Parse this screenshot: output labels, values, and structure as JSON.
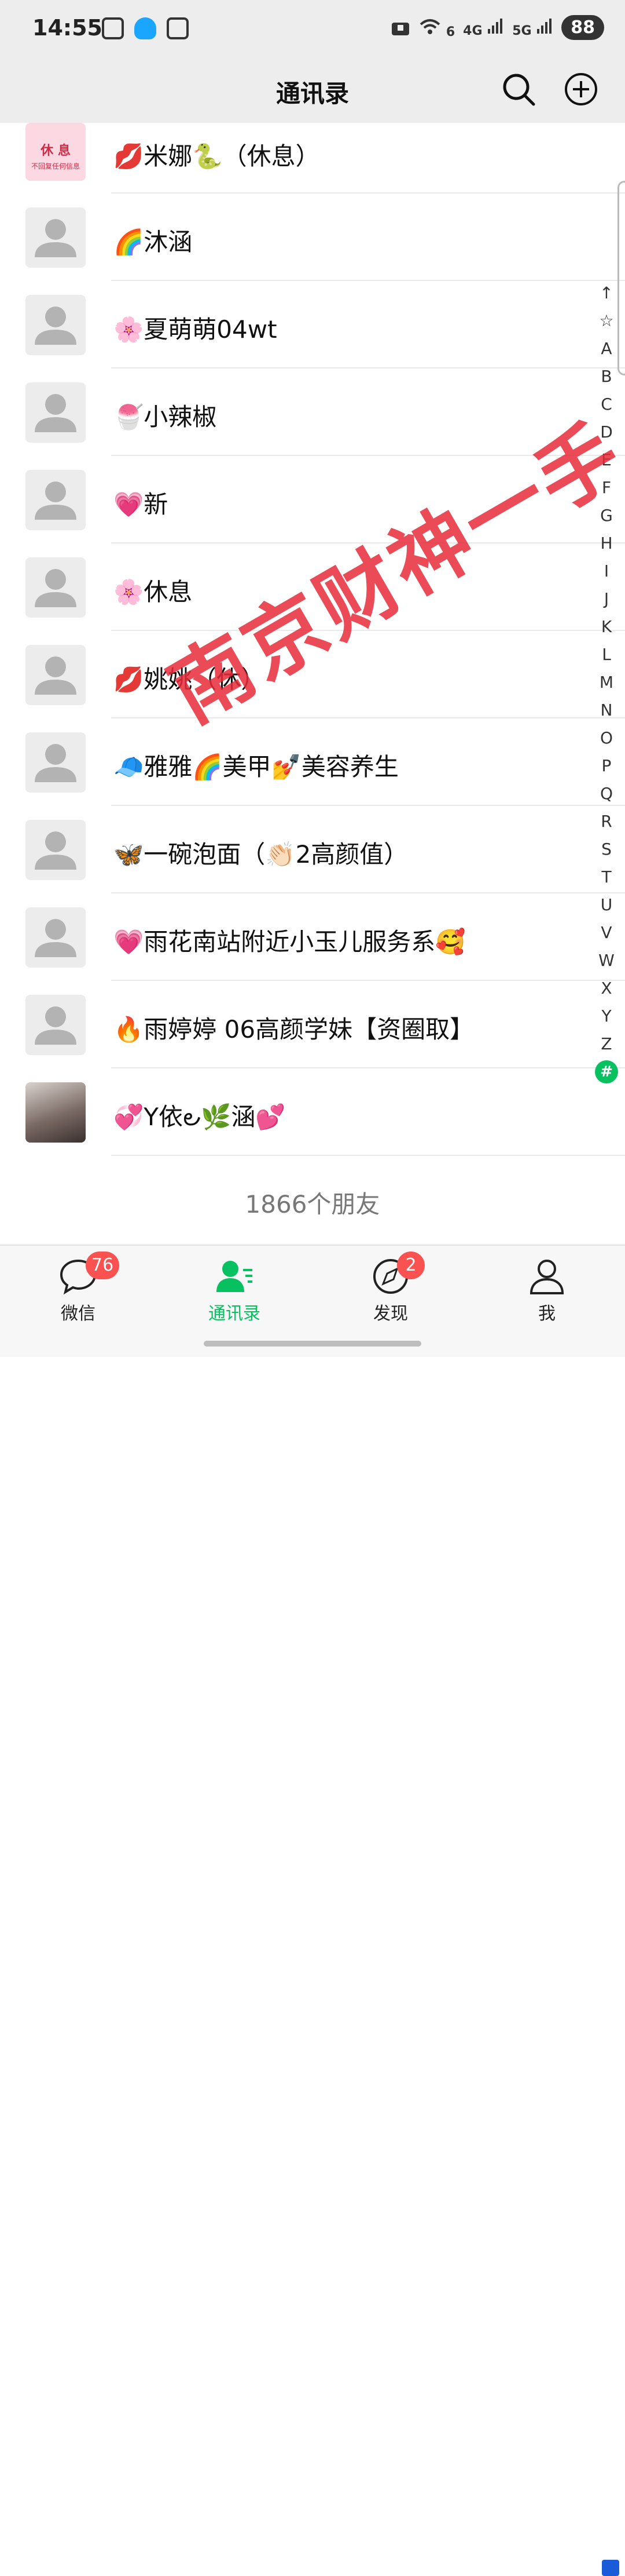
{
  "status_bar": {
    "time": "14:55",
    "battery": "88",
    "net_4g": "4G",
    "net_5g": "5G",
    "wifi_sub": "6"
  },
  "header": {
    "title": "通讯录"
  },
  "first_contact": {
    "name": "💋米娜🐍（休息）",
    "avatar_text": "休 息",
    "avatar_subtext": "不回复任何信息"
  },
  "contacts": [
    {
      "name": "🌈沐涵"
    },
    {
      "name": "🌸夏萌萌04wt"
    },
    {
      "name": "🍧小辣椒"
    },
    {
      "name": "💗新"
    },
    {
      "name": "🌸休息"
    },
    {
      "name": "💋姚姚（休）"
    },
    {
      "name": "🧢雅雅🌈美甲💅美容养生"
    },
    {
      "name": "🦋一碗泡面（👏🏻2高颜值）"
    },
    {
      "name": "💗雨花南站附近小玉儿服务系🥰"
    },
    {
      "name": "🔥雨婷婷 06高颜学妹【资圈取】"
    },
    {
      "name": "💞Y依౿🌿涵💕"
    }
  ],
  "friend_count": "1866个朋友",
  "index_letters": [
    "↑",
    "☆",
    "A",
    "B",
    "C",
    "D",
    "E",
    "F",
    "G",
    "H",
    "I",
    "J",
    "K",
    "L",
    "M",
    "N",
    "O",
    "P",
    "Q",
    "R",
    "S",
    "T",
    "U",
    "V",
    "W",
    "X",
    "Y",
    "Z",
    "#"
  ],
  "watermark": "南京财神一手",
  "tabs": [
    {
      "label": "微信",
      "badge": "76"
    },
    {
      "label": "通讯录",
      "badge": ""
    },
    {
      "label": "发现",
      "badge": "2"
    },
    {
      "label": "我",
      "badge": ""
    }
  ],
  "colors": {
    "accent": "#07c160",
    "badge": "#fa5151",
    "watermark": "#e82a3a"
  }
}
